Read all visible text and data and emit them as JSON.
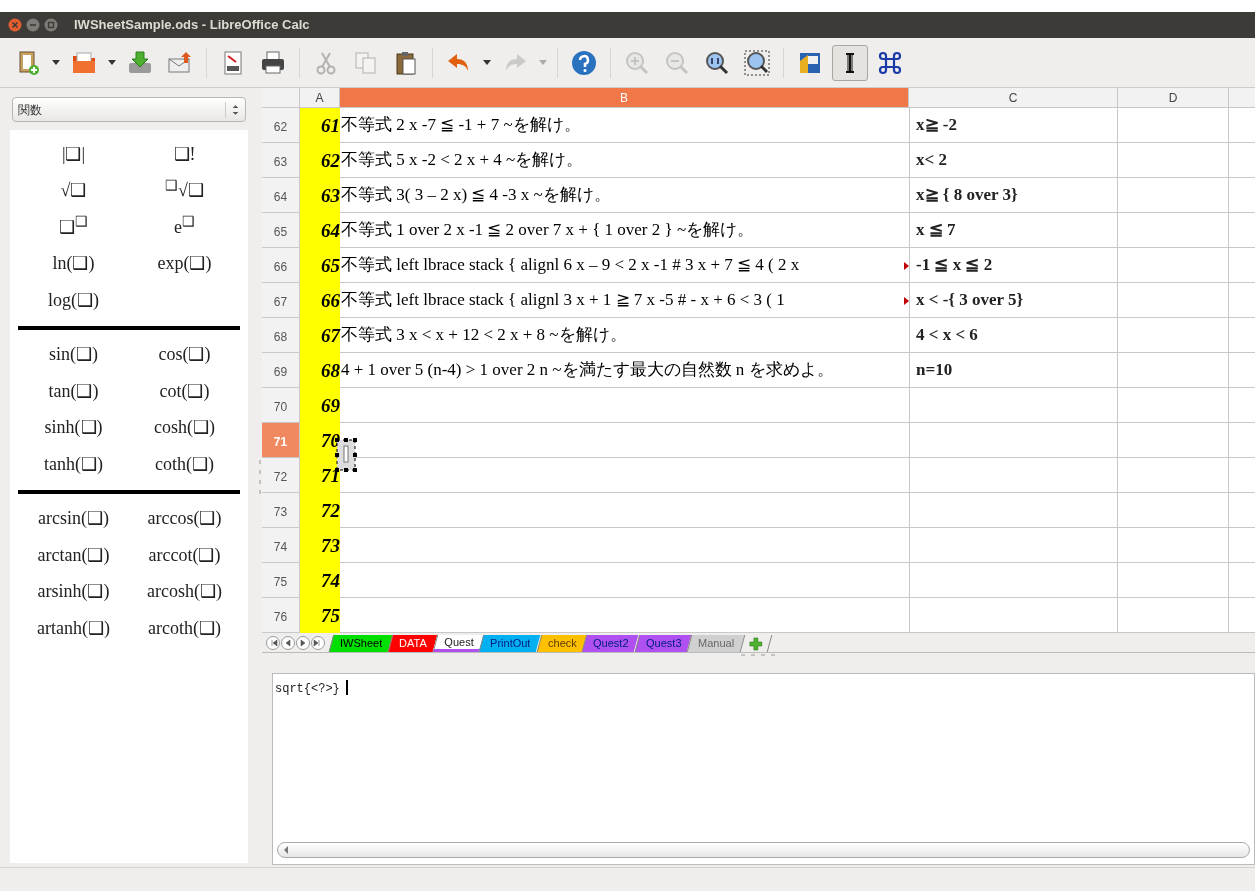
{
  "window": {
    "title": "IWSheetSample.ods - LibreOffice Calc"
  },
  "toolbar": [
    [
      {
        "kind": "new",
        "dropdown": true,
        "disabled": false,
        "pressed": false
      },
      {
        "kind": "open",
        "dropdown": true,
        "disabled": false,
        "pressed": false
      },
      {
        "kind": "save",
        "disabled": false,
        "pressed": false
      },
      {
        "kind": "mail",
        "disabled": false,
        "pressed": false
      }
    ],
    [
      {
        "kind": "pdf",
        "disabled": false,
        "pressed": false
      },
      {
        "kind": "print",
        "disabled": false,
        "pressed": false
      }
    ],
    [
      {
        "kind": "cut",
        "disabled": true,
        "pressed": false
      },
      {
        "kind": "copy",
        "disabled": true,
        "pressed": false
      },
      {
        "kind": "paste",
        "disabled": false,
        "pressed": false
      }
    ],
    [
      {
        "kind": "undo",
        "dropdown": true,
        "disabled": false,
        "pressed": false
      },
      {
        "kind": "redo",
        "dropdown": true,
        "disabled": true,
        "pressed": false
      }
    ],
    [
      {
        "kind": "help",
        "disabled": false,
        "pressed": false
      }
    ],
    [
      {
        "kind": "zoom_in",
        "disabled": true,
        "pressed": false
      },
      {
        "kind": "zoom_out",
        "disabled": true,
        "pressed": false
      },
      {
        "kind": "zoom_100",
        "disabled": false,
        "pressed": false
      },
      {
        "kind": "zoom_page",
        "disabled": false,
        "pressed": false
      }
    ],
    [
      {
        "kind": "image",
        "disabled": false,
        "pressed": false
      },
      {
        "kind": "cursor",
        "disabled": false,
        "pressed": true
      },
      {
        "kind": "command",
        "disabled": false,
        "pressed": false
      }
    ]
  ],
  "sidebar": {
    "category": "関数",
    "sections": [
      {
        "items": [
          "|❑|",
          "❑!",
          "√❑",
          "$^{❑}$√❑",
          "❑$^{❑}$",
          "e$^{❑}$",
          "ln(❑)",
          "exp(❑)",
          "log(❑)"
        ]
      },
      {
        "items": [
          "sin(❑)",
          "cos(❑)",
          "tan(❑)",
          "cot(❑)",
          "sinh(❑)",
          "cosh(❑)",
          "tanh(❑)",
          "coth(❑)"
        ]
      },
      {
        "items": [
          "arcsin(❑)",
          "arccos(❑)",
          "arctan(❑)",
          "arccot(❑)",
          "arsinh(❑)",
          "arcosh(❑)",
          "artanh(❑)",
          "arcoth(❑)"
        ]
      }
    ]
  },
  "sheet": {
    "columns": [
      {
        "label": "A",
        "selected": false
      },
      {
        "label": "B",
        "selected": true
      },
      {
        "label": "C",
        "selected": false
      },
      {
        "label": "D",
        "selected": false
      }
    ],
    "rows": [
      {
        "header": "62",
        "selected": false,
        "a": "61",
        "b": "不等式 2 x -7 ≦ -1 + 7 ~を解け。",
        "c": "x≧ -2"
      },
      {
        "header": "63",
        "selected": false,
        "a": "62",
        "b": "不等式 5 x -2 < 2 x + 4 ~を解け。",
        "c": "x< 2"
      },
      {
        "header": "64",
        "selected": false,
        "a": "63",
        "b": "不等式 3( 3 – 2 x) ≦ 4 -3 x ~を解け。",
        "c": "x≧ { 8 over 3}"
      },
      {
        "header": "65",
        "selected": false,
        "a": "64",
        "b": "不等式 1 over 2 x -1 ≦ 2 over 7 x + { 1 over 2 } ~を解け。",
        "c": "x ≦ 7"
      },
      {
        "header": "66",
        "selected": false,
        "a": "65",
        "b": "不等式 left lbrace stack { alignl 6 x – 9 < 2 x -1 # 3 x + 7 ≦ 4 ( 2 x",
        "c": "-1 ≦ x ≦ 2",
        "overflow": true
      },
      {
        "header": "67",
        "selected": false,
        "a": "66",
        "b": "不等式 left lbrace stack { alignl 3 x + 1  ≧  7 x -5 # - x + 6 < 3 ( 1",
        "c": "x < -{ 3 over 5}",
        "overflow": true
      },
      {
        "header": "68",
        "selected": false,
        "a": "67",
        "b": "不等式 3 x < x + 12 < 2 x + 8 ~を解け。",
        "c": "4 < x < 6"
      },
      {
        "header": "69",
        "selected": false,
        "a": "68",
        "b": "4 + 1 over 5 (n-4) > 1 over 2 n ~を満たす最大の自然数 n を求めよ。",
        "c": "n=10"
      },
      {
        "header": "70",
        "selected": false,
        "a": "69"
      },
      {
        "header": "71",
        "selected": true,
        "a": "70"
      },
      {
        "header": "72",
        "selected": false,
        "a": "71"
      },
      {
        "header": "73",
        "selected": false,
        "a": "72"
      },
      {
        "header": "74",
        "selected": false,
        "a": "73"
      },
      {
        "header": "75",
        "selected": false,
        "a": "74"
      },
      {
        "header": "76",
        "selected": false,
        "a": "75"
      }
    ]
  },
  "sheet_tabs": [
    {
      "label": "IWSheet",
      "color": "#00e000",
      "selected": false
    },
    {
      "label": "DATA",
      "color": "#ff0000",
      "selected": false
    },
    {
      "label": "Quest",
      "color": "#b050f0",
      "selected": true
    },
    {
      "label": "PrintOut",
      "color": "#00b0f0",
      "selected": false
    },
    {
      "label": "check",
      "color": "#ffc000",
      "selected": false
    },
    {
      "label": "Quest2",
      "color": "#b050f0",
      "selected": false
    },
    {
      "label": "Quest3",
      "color": "#b050f0",
      "selected": false
    },
    {
      "label": "Manual",
      "color": "#d0d0d0",
      "selected": false
    }
  ],
  "editor": {
    "text": "sqrt{<?>}"
  }
}
